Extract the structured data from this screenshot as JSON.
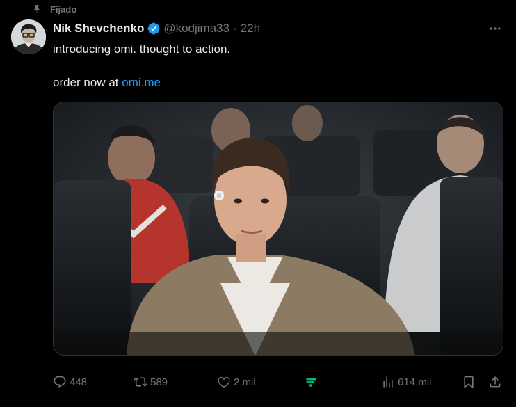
{
  "pinned": {
    "label": "Fijado"
  },
  "tweet": {
    "author_name": "Nik Shevchenko",
    "handle": "@kodjima33",
    "separator": "·",
    "time": "22h",
    "line1": "introducing omi. thought to action.",
    "line2_prefix": "order now at ",
    "line2_link": "omi.me"
  },
  "actions": {
    "replies": "448",
    "reposts": "589",
    "likes": "2 mil",
    "views": "614 mil"
  },
  "icons": {
    "pin": "pin-icon",
    "verified": "verified-badge-icon",
    "more": "more-icon",
    "reply": "reply-icon",
    "repost": "repost-icon",
    "like": "like-icon",
    "grok": "grok-app-icon",
    "views": "views-icon",
    "bookmark": "bookmark-icon",
    "share": "share-icon"
  },
  "colors": {
    "background": "#000000",
    "text": "#e7e9ea",
    "muted": "#71767b",
    "link": "#1d9bf0",
    "verified": "#1d9bf0",
    "grok_green": "#00ba7c"
  }
}
